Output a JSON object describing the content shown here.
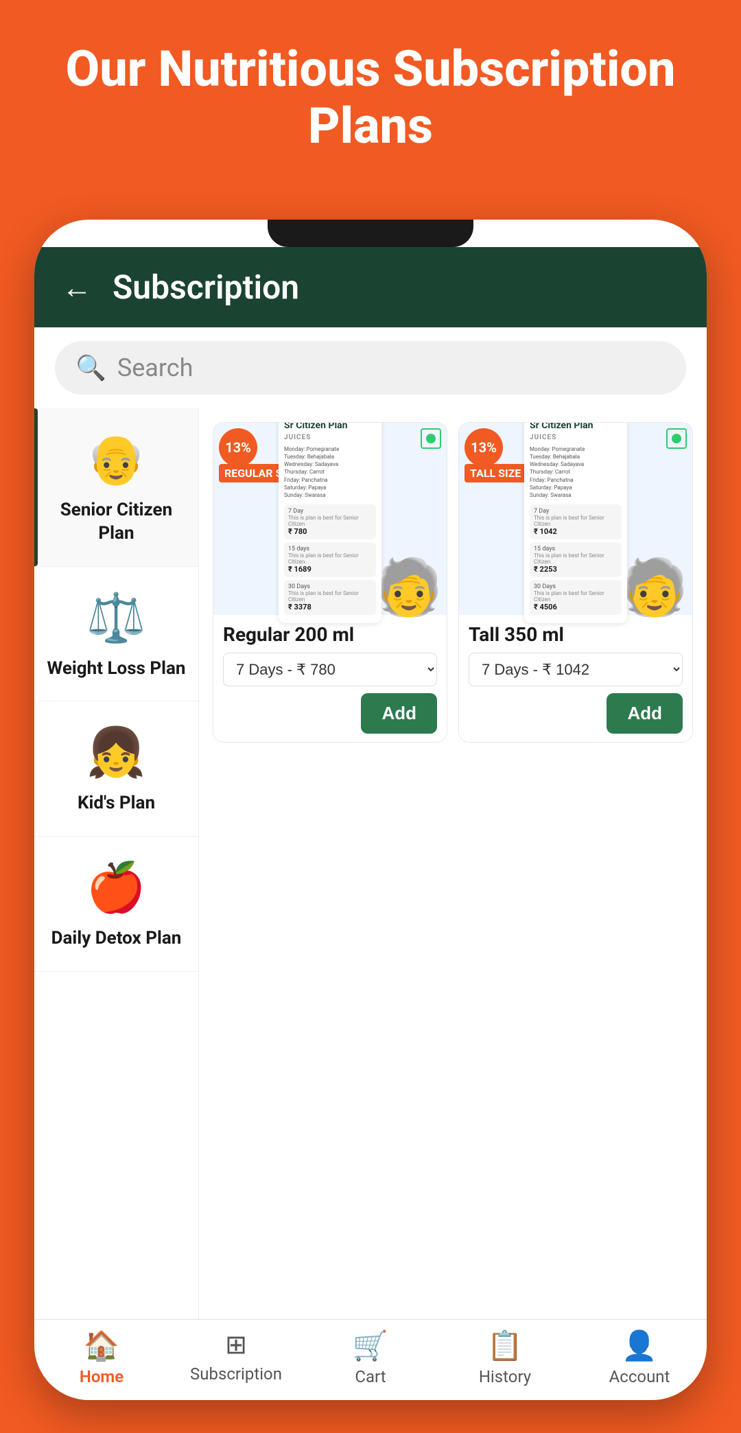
{
  "page": {
    "header": {
      "title": "Our Nutritious Subscription Plans"
    },
    "app": {
      "topbar": {
        "title": "Subscription",
        "back_label": "←"
      },
      "search": {
        "placeholder": "Search"
      },
      "sidebar": {
        "items": [
          {
            "id": "senior",
            "label": "Senior Citizen Plan",
            "icon": "👴",
            "active": true
          },
          {
            "id": "weightloss",
            "label": "Weight Loss Plan",
            "icon": "⚖️",
            "active": false
          },
          {
            "id": "kids",
            "label": "Kid's Plan",
            "icon": "👧",
            "active": false
          },
          {
            "id": "detox",
            "label": "Daily Detox Plan",
            "icon": "🍎",
            "active": false
          }
        ]
      },
      "products": [
        {
          "id": "regular",
          "title": "Regular 200 ml",
          "discount": "13%",
          "size_badge": "ReGULAR SIZE",
          "subtitle": "JUICES",
          "schedule": "Monday: Pomegranate\nTuesday: Behajabala\nWednesday: Sadayava\nThursday: Carrot\nFriday: Panchatna\nSaturday: Papaya\nSunday: Swarasa",
          "plans": [
            {
              "duration": "7 Day",
              "note": "This is plan is best for Senior Citizen",
              "price": "₹ 780"
            },
            {
              "duration": "15 days",
              "note": "This is plan is best for Senior Citizen",
              "price": "₹ 1689"
            },
            {
              "duration": "30 Days",
              "note": "This is plan is best for Senior Citizen",
              "price": "₹ 3378"
            }
          ],
          "select_option": "7 Days - ₹ 780",
          "add_label": "Add"
        },
        {
          "id": "tall",
          "title": "Tall 350 ml",
          "discount": "13%",
          "size_badge": "TALL SIZE",
          "subtitle": "JUICES",
          "schedule": "Monday: Pomegranate\nTuesday: Behajabala\nWednesday: Sadayava\nThursday: Carrot\nFriday: Panchatna\nSaturday: Papaya\nSunday: Swarasa",
          "plans": [
            {
              "duration": "7 Day",
              "note": "This is plan is best for Senior Citizen",
              "price": "₹ 1042"
            },
            {
              "duration": "15 days",
              "note": "This is plan is best for Senior Citizen",
              "price": "₹ 2253"
            },
            {
              "duration": "30 Days",
              "note": "This is plan is best for Senior Citizen",
              "price": "₹ 4506"
            }
          ],
          "select_option": "7 Days - ₹ 1042",
          "add_label": "Add"
        }
      ],
      "bottom_nav": [
        {
          "id": "home",
          "label": "Home",
          "icon": "🏠",
          "active": true
        },
        {
          "id": "subscription",
          "label": "Subscription",
          "icon": "⊞",
          "active": false
        },
        {
          "id": "cart",
          "label": "Cart",
          "icon": "🛒",
          "active": false
        },
        {
          "id": "history",
          "label": "History",
          "icon": "📋",
          "active": false
        },
        {
          "id": "account",
          "label": "Account",
          "icon": "👤",
          "active": false
        }
      ]
    }
  }
}
